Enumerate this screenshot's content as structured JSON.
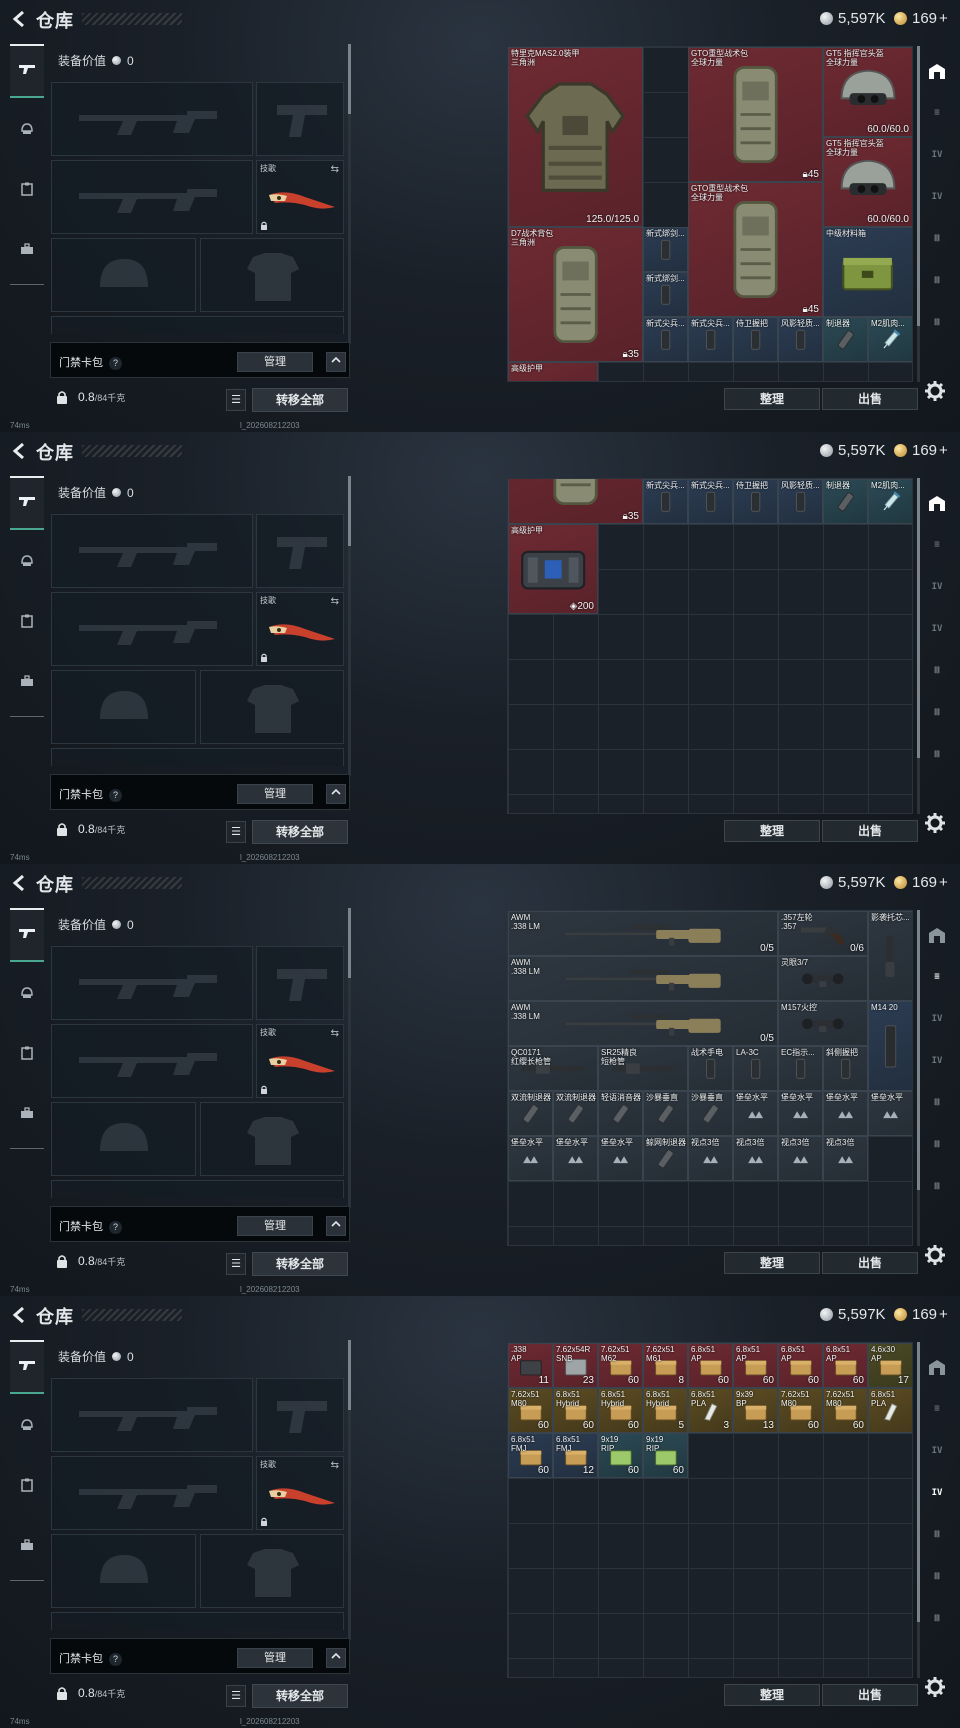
{
  "header": {
    "title": "仓库",
    "silver": "5,597K",
    "gold": "169",
    "gold_plus": "+"
  },
  "status": {
    "ping": "74ms",
    "build": "l_202608212203"
  },
  "equipment": {
    "value_label": "装备价值",
    "value": "0",
    "melee_label": "技歌"
  },
  "keycard": {
    "label": "门禁卡包",
    "help": "?",
    "manage": "管理",
    "caret": "^"
  },
  "weight": {
    "value": "0.8",
    "max": "/84千克"
  },
  "actions": {
    "transfer_all": "转移全部",
    "tidy": "整理",
    "sell": "出售",
    "list": "☰"
  },
  "panels": [
    {
      "active_tab": 0,
      "items": [
        {
          "name": "特里克MAS2.0装甲\n三角洲",
          "qty": "125.0/125.0",
          "color": "red",
          "art": "armor"
        },
        {
          "name": "GTO重型战术包\n全球力量",
          "qty": "45",
          "qtyicon": "lock",
          "color": "red",
          "art": "backpack"
        },
        {
          "name": "GT5 指挥官头盔\n全球力量",
          "qty": "60.0/60.0",
          "color": "red",
          "art": "helmet"
        },
        {
          "name": "GT5 指挥官头盔\n全球力量",
          "qty": "60.0/60.0",
          "color": "red",
          "art": "helmet"
        },
        {
          "name": "GTO重型战术包\n全球力量",
          "qty": "45",
          "qtyicon": "lock",
          "color": "red",
          "art": "backpack"
        },
        {
          "name": "D7战术背包\n三角洲",
          "qty": "35",
          "qtyicon": "lock",
          "color": "red",
          "art": "backpack"
        },
        {
          "name": "新式绑剑...",
          "qty": "",
          "color": "blue",
          "art": "grip"
        },
        {
          "name": "新式绑剑...",
          "qty": "",
          "color": "blue",
          "art": "grip"
        },
        {
          "name": "中级材料箱",
          "qty": "",
          "color": "blue",
          "art": "box"
        },
        {
          "name": "新式尖兵...",
          "qty": "",
          "color": "blue",
          "art": "grip"
        },
        {
          "name": "新式尖兵...",
          "qty": "",
          "color": "blue",
          "art": "grip"
        },
        {
          "name": "侍卫握把",
          "qty": "",
          "color": "blue",
          "art": "grip"
        },
        {
          "name": "风影轻质...",
          "qty": "",
          "color": "blue",
          "art": "grip"
        },
        {
          "name": "制退器",
          "qty": "",
          "color": "teal",
          "art": "muzzle"
        },
        {
          "name": "M2肌肉...",
          "qty": "",
          "color": "teal",
          "art": "syringe"
        },
        {
          "name": "高级护甲",
          "qty": "",
          "color": "red",
          "art": "none"
        }
      ]
    },
    {
      "active_tab": 0,
      "items": [
        {
          "name": "",
          "qty": "35",
          "qtyicon": "lock",
          "color": "red",
          "art": "backpack"
        },
        {
          "name": "新式绑剑...",
          "qty": "",
          "color": "blue",
          "art": "grip"
        },
        {
          "name": "",
          "qty": "45",
          "qtyicon": "lock",
          "color": "red",
          "art": "backpack"
        },
        {
          "name": "",
          "qty": "",
          "color": "blue",
          "art": "box"
        },
        {
          "name": "新式尖兵...",
          "qty": "",
          "color": "blue",
          "art": "grip"
        },
        {
          "name": "新式尖兵...",
          "qty": "",
          "color": "blue",
          "art": "grip"
        },
        {
          "name": "侍卫握把",
          "qty": "",
          "color": "blue",
          "art": "grip"
        },
        {
          "name": "风影轻质...",
          "qty": "",
          "color": "blue",
          "art": "grip"
        },
        {
          "name": "制退器",
          "qty": "",
          "color": "teal",
          "art": "muzzle"
        },
        {
          "name": "M2肌肉...",
          "qty": "",
          "color": "teal",
          "art": "syringe"
        },
        {
          "name": "高级护甲",
          "qty": "200",
          "qtyicon": "shield",
          "color": "red",
          "art": "case"
        }
      ]
    },
    {
      "active_tab": 1,
      "items": [
        {
          "name": "AWM\n.338 LM",
          "qty": "0/5",
          "color": "gray",
          "art": "sniper"
        },
        {
          "name": ".357左轮\n.357",
          "qty": "0/6",
          "color": "gray",
          "art": "revolver"
        },
        {
          "name": "影袭托芯...",
          "qty": "",
          "color": "gray",
          "art": "stock"
        },
        {
          "name": "AWM\n.338 LM",
          "qty": "",
          "color": "gray",
          "art": "sniper"
        },
        {
          "name": "灵眼3/7",
          "qty": "",
          "color": "gray",
          "art": "scope"
        },
        {
          "name": "AWM\n.338 LM",
          "qty": "0/5",
          "color": "gray",
          "art": "sniper"
        },
        {
          "name": "M157火控",
          "qty": "",
          "color": "gray",
          "art": "scope"
        },
        {
          "name": "M14 20",
          "qty": "",
          "color": "blue",
          "art": "mag"
        },
        {
          "name": "QC0171\n红缨长枪管",
          "qty": "",
          "color": "gray",
          "art": "barrel"
        },
        {
          "name": "SR25精良\n短枪管",
          "qty": "",
          "color": "gray",
          "art": "barrel"
        },
        {
          "name": "战术手电",
          "qty": "",
          "color": "gray",
          "art": "grip"
        },
        {
          "name": "LA-3C",
          "qty": "",
          "color": "gray",
          "art": "grip"
        },
        {
          "name": "EC指示...",
          "qty": "",
          "color": "gray",
          "art": "grip"
        },
        {
          "name": "斜侧握把",
          "qty": "",
          "color": "gray",
          "art": "grip"
        },
        {
          "name": "双流制退器",
          "qty": "",
          "color": "gray",
          "art": "muzzle"
        },
        {
          "name": "双流制退器",
          "qty": "",
          "color": "gray",
          "art": "muzzle"
        },
        {
          "name": "轻语消音器",
          "qty": "",
          "color": "gray",
          "art": "muzzle"
        },
        {
          "name": "沙暴垂直",
          "qty": "",
          "color": "gray",
          "art": "muzzle"
        },
        {
          "name": "沙暴垂直",
          "qty": "",
          "color": "gray",
          "art": "muzzle"
        },
        {
          "name": "堡垒水平",
          "qty": "",
          "color": "gray",
          "art": "tri"
        },
        {
          "name": "堡垒水平",
          "qty": "",
          "color": "gray",
          "art": "tri"
        },
        {
          "name": "堡垒水平",
          "qty": "",
          "color": "gray",
          "art": "tri"
        },
        {
          "name": "堡垒水平",
          "qty": "",
          "color": "gray",
          "art": "tri"
        },
        {
          "name": "堡垒水平",
          "qty": "",
          "color": "gray",
          "art": "tri"
        },
        {
          "name": "堡垒水平",
          "qty": "",
          "color": "gray",
          "art": "tri"
        },
        {
          "name": "堡垒水平",
          "qty": "",
          "color": "gray",
          "art": "tri"
        },
        {
          "name": "鲸网制退器",
          "qty": "",
          "color": "gray",
          "art": "muzzle"
        },
        {
          "name": "视点3倍",
          "qty": "",
          "color": "gray",
          "art": "tri"
        },
        {
          "name": "视点3倍",
          "qty": "",
          "color": "gray",
          "art": "tri"
        },
        {
          "name": "视点3倍",
          "qty": "",
          "color": "gray",
          "art": "tri"
        },
        {
          "name": "视点3倍",
          "qty": "",
          "color": "gray",
          "art": "tri"
        }
      ]
    },
    {
      "active_tab": 3,
      "items": [
        {
          "name": ".338\nAP",
          "qty": "11",
          "color": "red",
          "art": "ammo-dark"
        },
        {
          "name": "7.62x54R\nSNB",
          "qty": "23",
          "color": "red",
          "art": "ammo-box"
        },
        {
          "name": "7.62x51\nM62",
          "qty": "60",
          "color": "red",
          "art": "ammo-gold"
        },
        {
          "name": "7.62x51\nM61",
          "qty": "8",
          "color": "red",
          "art": "ammo-gold"
        },
        {
          "name": "6.8x51\nAP",
          "qty": "60",
          "color": "red",
          "art": "ammo-gold"
        },
        {
          "name": "6.8x51\nAP",
          "qty": "60",
          "color": "red",
          "art": "ammo-gold"
        },
        {
          "name": "6.8x51\nAP",
          "qty": "60",
          "color": "red",
          "art": "ammo-gold"
        },
        {
          "name": "6.8x51\nAP",
          "qty": "60",
          "color": "red",
          "art": "ammo-gold"
        },
        {
          "name": "4.6x30\nAP",
          "qty": "17",
          "color": "olive",
          "art": "ammo-gold"
        },
        {
          "name": "7.62x51\nM80",
          "qty": "60",
          "color": "gold",
          "art": "ammo-gold"
        },
        {
          "name": "6.8x51\nHybrid",
          "qty": "60",
          "color": "gold",
          "art": "ammo-gold"
        },
        {
          "name": "6.8x51\nHybrid",
          "qty": "60",
          "color": "gold",
          "art": "ammo-gold"
        },
        {
          "name": "6.8x51\nHybrid",
          "qty": "5",
          "color": "gold",
          "art": "ammo-gold"
        },
        {
          "name": "6.8x51\nPLA",
          "qty": "3",
          "color": "gold",
          "art": "ammo-white"
        },
        {
          "name": "9x39\nBP",
          "qty": "13",
          "color": "gold",
          "art": "ammo-gold"
        },
        {
          "name": "7.62x51\nM80",
          "qty": "60",
          "color": "gold",
          "art": "ammo-gold"
        },
        {
          "name": "7.62x51\nM80",
          "qty": "60",
          "color": "gold",
          "art": "ammo-gold"
        },
        {
          "name": "6.8x51\nPLA",
          "qty": "",
          "color": "gold",
          "art": "ammo-white"
        },
        {
          "name": "6.8x51\nFMJ",
          "qty": "60",
          "color": "blue",
          "art": "ammo-gold"
        },
        {
          "name": "6.8x51\nFMJ",
          "qty": "12",
          "color": "blue",
          "art": "ammo-gold"
        },
        {
          "name": "9x19\nRIP",
          "qty": "60",
          "color": "teal",
          "art": "ammo-green"
        },
        {
          "name": "9x19\nRIP",
          "qty": "60",
          "color": "teal",
          "art": "ammo-green"
        }
      ]
    }
  ],
  "right_tabs": [
    "□",
    "≡",
    "IV",
    "IV",
    "Ⅲ",
    "Ⅲ",
    "Ⅲ"
  ],
  "left_tabs": [
    "gun-icon",
    "helmet-icon",
    "clipboard-icon",
    "toolbox-icon"
  ]
}
